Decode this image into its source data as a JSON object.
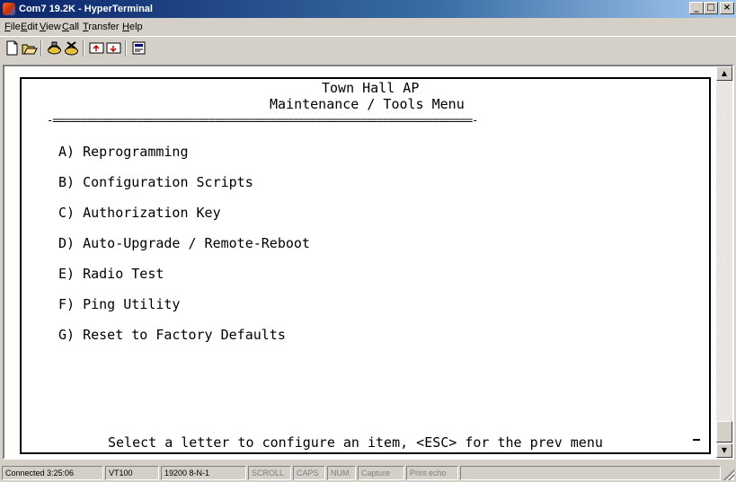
{
  "window": {
    "title": "Com7 19.2K - HyperTerminal",
    "controls": {
      "minimize": "_",
      "maximize": "□",
      "close": "×"
    }
  },
  "menubar": [
    {
      "key": "F",
      "rest": "ile"
    },
    {
      "key": "E",
      "rest": "dit"
    },
    {
      "key": "V",
      "rest": "iew"
    },
    {
      "key": "C",
      "rest": "all"
    },
    {
      "key": "T",
      "rest": "ransfer"
    },
    {
      "key": "H",
      "rest": "elp"
    }
  ],
  "toolbar": {
    "icons": [
      "new-icon",
      "open-icon",
      "connect-icon",
      "disconnect-icon",
      "send-icon",
      "receive-icon",
      "properties-icon"
    ]
  },
  "terminal": {
    "heading1": "Town Hall AP",
    "heading2": "Maintenance / Tools Menu",
    "separator": "-===========================================================================-",
    "options": [
      "A) Reprogramming",
      "B) Configuration Scripts",
      "C) Authorization Key",
      "D) Auto-Upgrade / Remote-Reboot",
      "E) Radio Test",
      "F) Ping Utility",
      "G) Reset to Factory Defaults"
    ],
    "prompt": "Select a letter to configure an item, <ESC> for the prev menu"
  },
  "scrollbar": {
    "up": "▲",
    "down": "▼"
  },
  "statusbar": {
    "connected": "Connected 3:25:06",
    "emulation": "VT100",
    "port_settings": "19200 8-N-1",
    "scroll": "SCROLL",
    "caps": "CAPS",
    "num": "NUM",
    "capture": "Capture",
    "print_echo": "Print echo"
  }
}
